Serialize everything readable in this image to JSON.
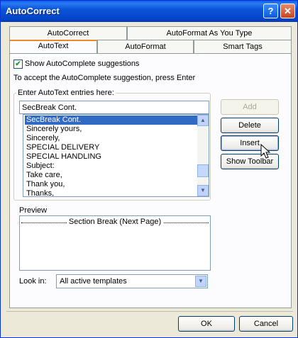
{
  "window": {
    "title": "AutoCorrect"
  },
  "titlebar": {
    "help_glyph": "?",
    "close_glyph": "✕"
  },
  "tabs": {
    "back_row": [
      "AutoCorrect",
      "AutoFormat As You Type"
    ],
    "front_row": [
      "AutoText",
      "AutoFormat",
      "Smart Tags"
    ],
    "selected": "AutoText"
  },
  "autotext": {
    "show_suggestions_label": "Show AutoComplete suggestions",
    "show_suggestions_checked": true,
    "instruction": "To accept the AutoComplete suggestion, press Enter",
    "entries_label": "Enter AutoText entries here:",
    "entry_value": "SecBreak Cont.",
    "entries": [
      "SecBreak Cont.",
      "Sincerely yours,",
      "Sincerely,",
      "SPECIAL DELIVERY",
      "SPECIAL HANDLING",
      "Subject:",
      "Take care,",
      "Thank you,",
      "Thanks,"
    ],
    "selected_entry": "SecBreak Cont.",
    "buttons": {
      "add": "Add",
      "delete": "Delete",
      "insert": "Insert",
      "show_toolbar": "Show Toolbar"
    },
    "preview_label": "Preview",
    "preview_text": "Section Break (Next Page)",
    "look_in_label": "Look in:",
    "look_in_value": "All active templates"
  },
  "footer": {
    "ok": "OK",
    "cancel": "Cancel"
  },
  "colors": {
    "title_bar": "#0a5fe8",
    "tab_highlight": "#e68b2c",
    "selection": "#316ac5"
  }
}
